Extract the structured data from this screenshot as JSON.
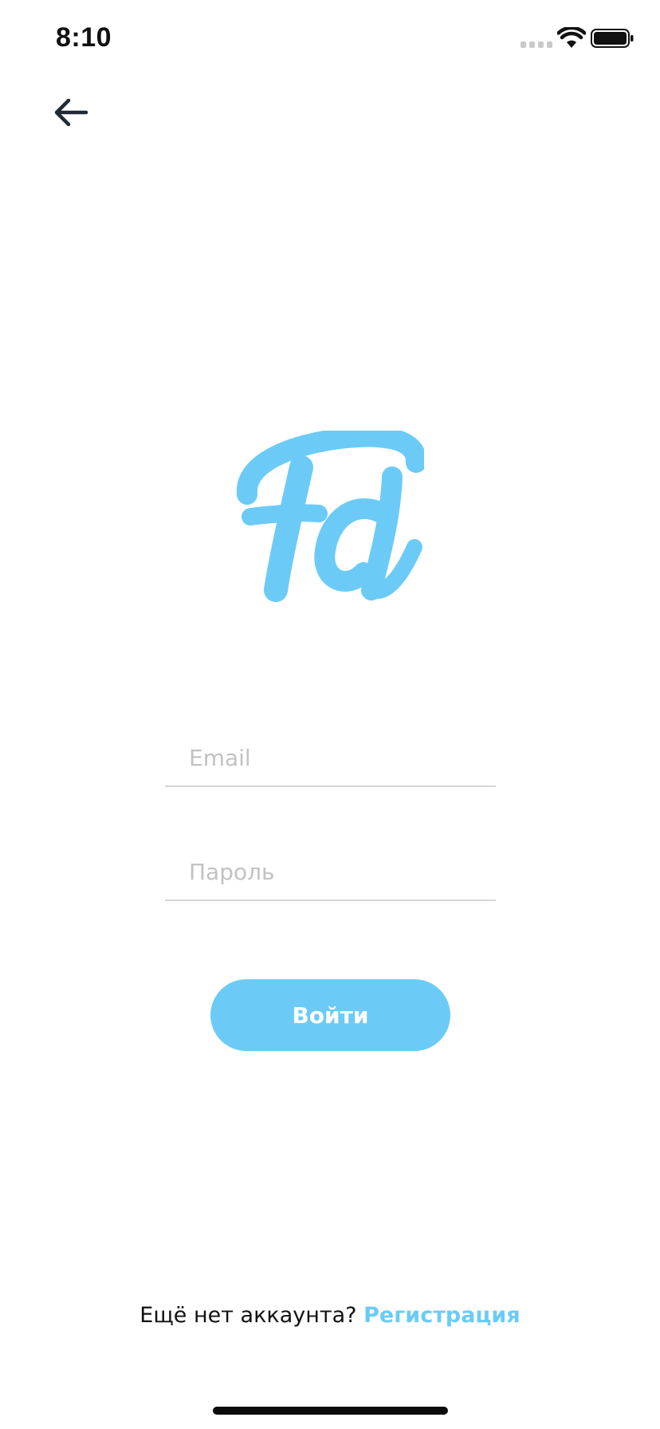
{
  "status_bar": {
    "time": "8:10",
    "icons": [
      "signal-icon",
      "wifi-icon",
      "battery-icon"
    ]
  },
  "nav": {
    "back_icon": "arrow-left-icon"
  },
  "logo": {
    "icon": "fd-logo-icon",
    "color": "#6ccbf6"
  },
  "form": {
    "email": {
      "placeholder": "Email",
      "value": ""
    },
    "password": {
      "placeholder": "Пароль",
      "value": ""
    },
    "submit_label": "Войти"
  },
  "footer": {
    "prompt": "Ещё нет аккаунта?",
    "link_label": "Регистрация"
  },
  "colors": {
    "accent": "#6ccbf6",
    "text": "#111111",
    "placeholder": "#c2c2c2",
    "divider": "#d6d6d6"
  }
}
